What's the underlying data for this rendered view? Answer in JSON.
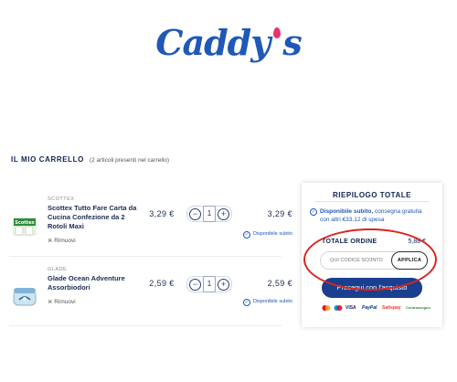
{
  "brand": {
    "logo_text": "Caddy",
    "logo_suffix": "s",
    "accent_color": "#1f58b8",
    "drop_color": "#e8336f"
  },
  "cart": {
    "title": "IL MIO CARRELLO",
    "count_text": "(2 articoli presenti nel carrello)",
    "items": [
      {
        "brand": "SCOTTEX",
        "name": "Scottex Tutto Fare Carta da Cucina Confezione da 2 Rotoli Maxi",
        "remove_label": "Rimuovi",
        "unit_price": "3,29 €",
        "quantity": "1",
        "total": "3,29 €",
        "availability": "Disponibile subito",
        "thumb_icon": "paper-towel-pack"
      },
      {
        "brand": "GLADE",
        "name": "Glade Ocean Adventure Assorbiodori",
        "remove_label": "Rimuovi",
        "unit_price": "2,59 €",
        "quantity": "1",
        "total": "2,59 €",
        "availability": "Disponibile subito",
        "thumb_icon": "odor-absorber-jar"
      }
    ]
  },
  "summary": {
    "title": "RIEPILOGO TOTALE",
    "availability_bold": "Disponibile subito,",
    "availability_rest": " consegna gratuita con altri €33,12 di spesa",
    "order_label": "TOTALE ORDINE",
    "order_total": "5,88 €",
    "coupon_placeholder": "QUI CODICE SCONTO",
    "apply_label": "APPLICA",
    "proceed_label": "Prosegui con l'acquisto",
    "payments": [
      "mastercard",
      "maestro",
      "VISA",
      "PayPal",
      "Satispay",
      "Contrassegno"
    ]
  }
}
